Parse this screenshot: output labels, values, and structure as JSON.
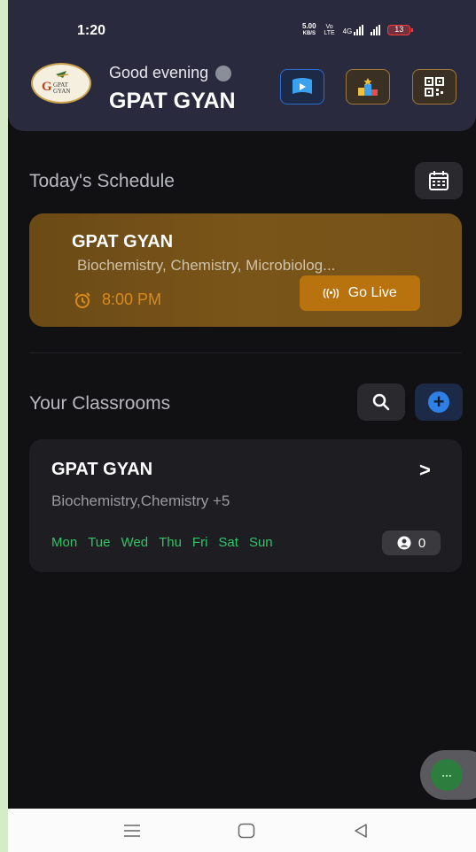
{
  "status_bar": {
    "time": "1:20",
    "net_speed_value": "5.00",
    "net_speed_unit": "KB/S",
    "volte": "Vo LTE",
    "network": "4G",
    "battery": "13"
  },
  "header": {
    "greeting": "Good evening",
    "name": "GPAT GYAN",
    "logo_text_top": "GPAT",
    "logo_text_bottom": "GYAN"
  },
  "schedule": {
    "title": "Today's Schedule",
    "card": {
      "title": "GPAT GYAN",
      "subjects": "Biochemistry, Chemistry, Microbiolog...",
      "time": "8:00 PM",
      "live_label": "Go Live"
    }
  },
  "classrooms": {
    "title": "Your Classrooms",
    "items": [
      {
        "title": "GPAT GYAN",
        "subjects": "Biochemistry,Chemistry +5",
        "days": [
          "Mon",
          "Tue",
          "Wed",
          "Thu",
          "Fri",
          "Sat",
          "Sun"
        ],
        "students": "0"
      }
    ]
  },
  "fab": {
    "label": "..."
  },
  "colors": {
    "accent_blue": "#2f80e4",
    "accent_orange": "#b8720e",
    "days_green": "#2fc46a",
    "background": "#111113"
  }
}
